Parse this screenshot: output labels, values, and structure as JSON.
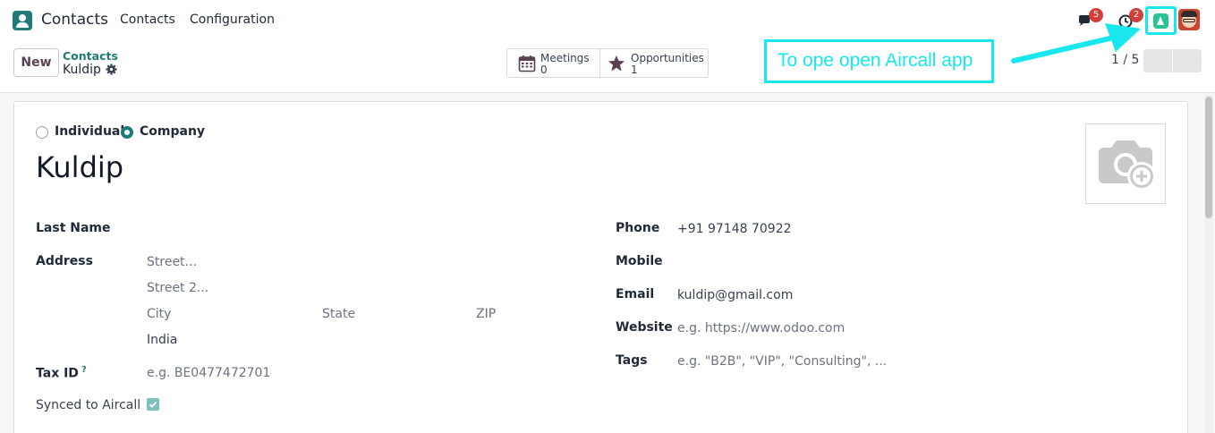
{
  "navbar": {
    "app_name": "Contacts",
    "menu": [
      "Contacts",
      "Configuration"
    ],
    "chat_count": "5",
    "activity_count": "2"
  },
  "control_panel": {
    "new_label": "New",
    "breadcrumb_parent": "Contacts",
    "breadcrumb_current": "Kuldip",
    "smart_buttons": [
      {
        "label": "Meetings",
        "value": "0",
        "icon": "calendar-icon"
      },
      {
        "label": "Opportunities",
        "value": "1",
        "icon": "star-icon"
      }
    ],
    "pager": "1 / 5"
  },
  "annotation": {
    "text": "To ope open Aircall app",
    "color": "#18e7ee"
  },
  "form": {
    "type_options": [
      "Individual",
      "Company"
    ],
    "type_selected": "Company",
    "name": "Kuldip",
    "left": {
      "last_name_label": "Last Name",
      "address_label": "Address",
      "street_placeholder": "Street...",
      "street2_placeholder": "Street 2...",
      "city_placeholder": "City",
      "state_placeholder": "State",
      "zip_placeholder": "ZIP",
      "country": "India",
      "tax_id_label": "Tax ID",
      "tax_id_help": "?",
      "tax_id_placeholder": "e.g. BE0477472701",
      "synced_label": "Synced to Aircall",
      "synced_checked": true
    },
    "right": {
      "phone_label": "Phone",
      "phone": "+91 97148 70922",
      "mobile_label": "Mobile",
      "email_label": "Email",
      "email": "kuldip@gmail.com",
      "website_label": "Website",
      "website_placeholder": "e.g. https://www.odoo.com",
      "tags_label": "Tags",
      "tags_placeholder": "e.g. \"B2B\", \"VIP\", \"Consulting\", ..."
    }
  },
  "colors": {
    "brand": "#1f7a78",
    "primary": "#5b3f52",
    "badge": "#d23f3a",
    "aircall": "#29c394"
  }
}
